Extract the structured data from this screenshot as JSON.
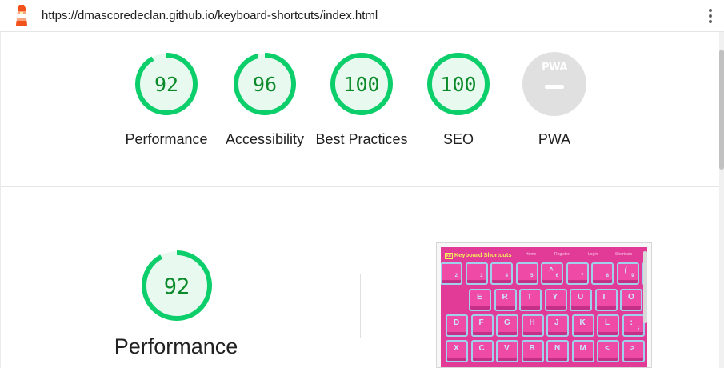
{
  "browser": {
    "url": "https://dmascoredeclan.github.io/keyboard-shortcuts/index.html"
  },
  "colors": {
    "pass": "#0cce6b",
    "pass_text": "#0b8a2a",
    "pass_fill": "#e8f9ef",
    "pwa_gray": "#e0e0e0"
  },
  "gauges": [
    {
      "score": "92",
      "label": "Performance",
      "value": 92
    },
    {
      "score": "96",
      "label": "Accessibility",
      "value": 96
    },
    {
      "score": "100",
      "label": "Best Practices",
      "value": 100
    },
    {
      "score": "100",
      "label": "SEO",
      "value": 100
    }
  ],
  "pwa": {
    "badge_text": "PWA",
    "label": "PWA"
  },
  "category": {
    "score": "92",
    "value": 92,
    "title": "Performance"
  },
  "screenshot": {
    "brand_badge": "kb",
    "brand": "Keyboard Shortcuts",
    "nav": [
      "Home",
      "Register",
      "Login",
      "Shortcuts"
    ],
    "rows": [
      [
        "",
        "",
        "",
        "",
        "^",
        "",
        "",
        "(",
        ")",
        "",
        ""
      ],
      [
        "E",
        "R",
        "T",
        "Y",
        "U",
        "I",
        "O",
        "P"
      ],
      [
        "D",
        "F",
        "G",
        "H",
        "J",
        "K",
        "L",
        ":"
      ],
      [
        "X",
        "C",
        "V",
        "B",
        "N",
        "M",
        "<",
        ">"
      ]
    ],
    "row_subs": [
      [
        "2",
        "3",
        "4",
        "5",
        "6",
        "7",
        "8",
        "9",
        "0",
        "",
        ""
      ],
      [],
      [
        "",
        "",
        "",
        "",
        "",
        "",
        "",
        ";"
      ],
      [
        "",
        "",
        "",
        "",
        "",
        "",
        ",",
        "."
      ]
    ]
  }
}
